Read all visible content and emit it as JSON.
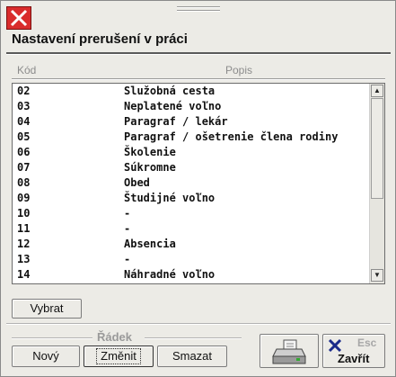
{
  "window": {
    "title": "Nastavení prerušení v práci"
  },
  "columns": {
    "code": "Kód",
    "description": "Popis"
  },
  "rows": [
    {
      "code": "02",
      "desc": "Služobná cesta"
    },
    {
      "code": "03",
      "desc": "Neplatené voľno"
    },
    {
      "code": "04",
      "desc": "Paragraf / lekár"
    },
    {
      "code": "05",
      "desc": "Paragraf / ošetrenie člena rodiny"
    },
    {
      "code": "06",
      "desc": "Školenie"
    },
    {
      "code": "07",
      "desc": "Súkromne"
    },
    {
      "code": "08",
      "desc": "Obed"
    },
    {
      "code": "09",
      "desc": "Študijné voľno"
    },
    {
      "code": "10",
      "desc": "-"
    },
    {
      "code": "11",
      "desc": "-"
    },
    {
      "code": "12",
      "desc": "Absencia"
    },
    {
      "code": "13",
      "desc": "-"
    },
    {
      "code": "14",
      "desc": "Náhradné voľno"
    }
  ],
  "buttons": {
    "select": "Vybrat",
    "group_label": "Řádek",
    "new": "Nový",
    "edit": "Změnit",
    "delete": "Smazat",
    "esc_hint": "Esc",
    "close": "Zavřít"
  },
  "icons": {
    "close": "close-x-icon",
    "print": "printer-icon",
    "close_x": "blue-x-icon"
  },
  "colors": {
    "close_red": "#d92c2c",
    "x_blue": "#1a2a8a"
  }
}
